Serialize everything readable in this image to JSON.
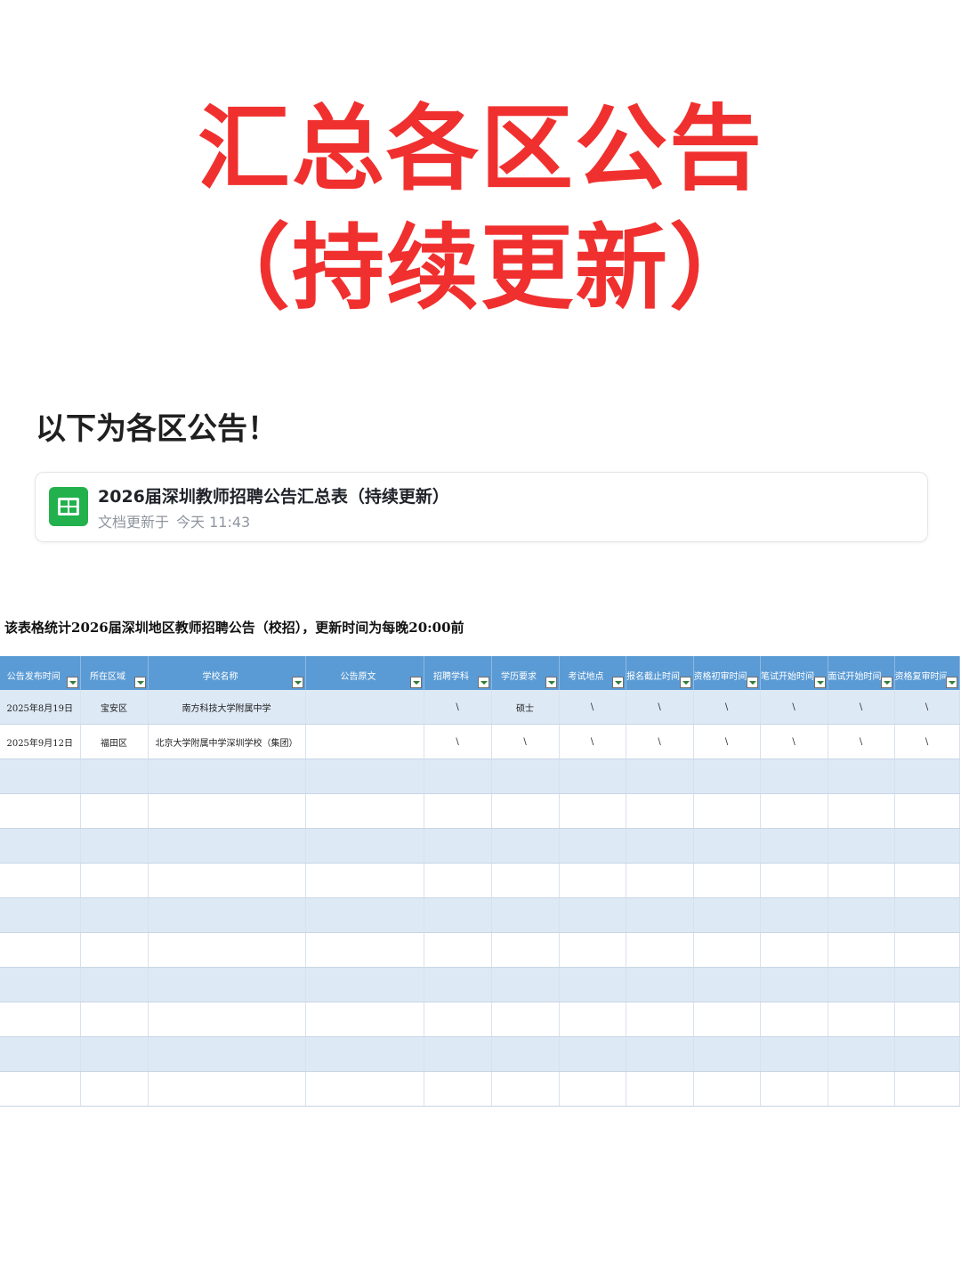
{
  "hero": {
    "line1": "汇总各区公告",
    "line2": "（持续更新）"
  },
  "intro_text": "以下为各区公告！",
  "doc_card": {
    "title": "2026届深圳教师招聘公告汇总表（持续更新）",
    "meta_label": "文档更新于",
    "meta_time": "今天 11:43",
    "icon": "spreadsheet-icon",
    "icon_color": "#22b14c"
  },
  "sheet": {
    "caption": "该表格统计2026届深圳地区教师招聘公告（校招），更新时间为每晚20:00前",
    "header_color": "#5b9bd5",
    "stripe_color": "#dde9f5",
    "columns": [
      "公告发布时间",
      "所在区域",
      "学校名称",
      "公告原文",
      "招聘学科",
      "学历要求",
      "考试地点",
      "报名截止时间",
      "资格初审时间",
      "笔试开始时间",
      "面试开始时间",
      "资格复审时间"
    ],
    "rows": [
      [
        "2025年8月19日",
        "宝安区",
        "南方科技大学附属中学",
        "",
        "\\",
        "硕士",
        "\\",
        "\\",
        "\\",
        "\\",
        "\\",
        "\\"
      ],
      [
        "2025年9月12日",
        "福田区",
        "北京大学附属中学深圳学校（集团）",
        "",
        "\\",
        "\\",
        "\\",
        "\\",
        "\\",
        "\\",
        "\\",
        "\\"
      ]
    ]
  }
}
